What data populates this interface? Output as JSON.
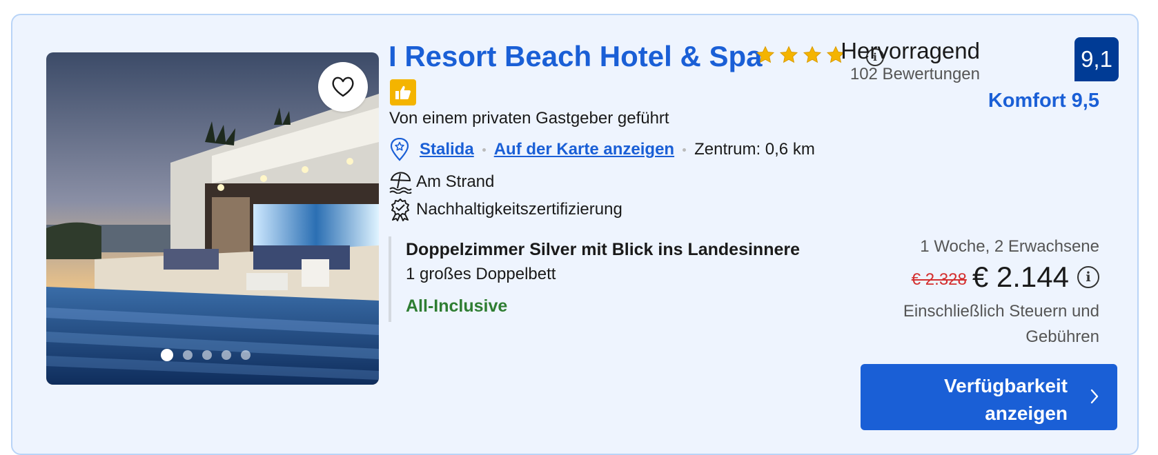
{
  "hotel": {
    "name": "I Resort Beach Hotel & Spa",
    "stars": 4,
    "star_color": "#f4b400",
    "host": "Von einem privaten Gastgeber geführt",
    "location": {
      "city": "Stalida",
      "map_link": "Auf der Karte anzeigen",
      "distance": "Zentrum: 0,6 km"
    },
    "features": [
      {
        "icon": "beach-umbrella-icon",
        "label": "Am Strand"
      },
      {
        "icon": "sustainability-badge-icon",
        "label": "Nachhaltigkeitszertifizierung"
      }
    ]
  },
  "gallery": {
    "dots": 5,
    "active_dot": 1
  },
  "room": {
    "name": "Doppelzimmer Silver mit Blick ins Landesinnere",
    "bed": "1 großes Doppelbett",
    "board": "All-Inclusive"
  },
  "rating": {
    "label": "Hervorragend",
    "reviews": "102 Bewertungen",
    "score": "9,1",
    "comfort": "Komfort 9,5"
  },
  "price": {
    "stay": "1 Woche, 2 Erwachsene",
    "old": "€ 2.328",
    "current": "€ 2.144",
    "taxes": "Einschließlich Steuern und Gebühren"
  },
  "cta": {
    "label": "Verfügbarkeit anzeigen"
  },
  "colors": {
    "primary_blue": "#1a5fd6",
    "score_blue": "#003b95",
    "green": "#2e7d32",
    "strike_red": "#d42f2f",
    "card_bg": "#eef4fe"
  }
}
